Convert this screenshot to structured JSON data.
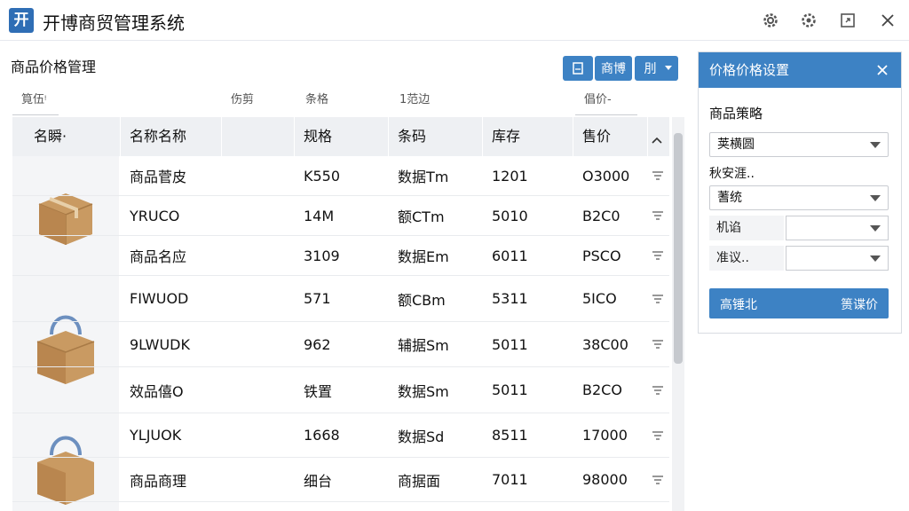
{
  "app": {
    "logo_glyph": "开",
    "title": "开博商贸管理系统",
    "accent": "#3d82c4"
  },
  "window_controls": [
    "settings-icon",
    "gear-icon",
    "maximize-icon",
    "close-icon"
  ],
  "page": {
    "title": "商品价格管理"
  },
  "toolbar": {
    "btn1_icon": "document-icon",
    "btn2_label": "商博",
    "btn3_label": "刖"
  },
  "filters": [
    "筧伍ᵎ",
    "",
    "伤剪",
    "条格",
    "1范边",
    "",
    "倡价-"
  ],
  "table": {
    "headers": [
      "名瞬·",
      "名称名称",
      "",
      "规格",
      "条码",
      "库存",
      "售价"
    ],
    "rows": [
      {
        "name": "商品菅皮",
        "spec": "K550",
        "code": "数据Tm",
        "stock": "1201",
        "price": "O3000"
      },
      {
        "name": "YRUCO",
        "spec": "14M",
        "code": "额CTm",
        "stock": "5010",
        "price": "B2C0"
      },
      {
        "name": "商品名应",
        "spec": "3109",
        "code": "数据Em",
        "stock": "6011",
        "price": "PSCO"
      },
      {
        "name": "FIWUOD",
        "spec": "571",
        "code": "额CBm",
        "stock": "5311",
        "price": "5ICO"
      },
      {
        "name": "9LWUDK",
        "spec": "962",
        "code": "辅据Sm",
        "stock": "5011",
        "price": "38C00"
      },
      {
        "name": "效品僖O",
        "spec": "铁置",
        "code": "数据Sm",
        "stock": "5011",
        "price": "B2CO"
      },
      {
        "name": "YLJUOK",
        "spec": "1668",
        "code": "数据Sd",
        "stock": "8511",
        "price": "17000"
      },
      {
        "name": "商品商理",
        "spec": "细台",
        "code": "商据面",
        "stock": "7011",
        "price": "98000"
      }
    ]
  },
  "panel": {
    "title": "价格价格设置",
    "section_label": "商品策略",
    "select1": "荚横圆",
    "label2": "秋安涯..",
    "select2": "蓍统",
    "field1_label": "机谄",
    "field2_label": "准议..",
    "btn_left": "高锤北",
    "btn_right": "篑谍价"
  }
}
